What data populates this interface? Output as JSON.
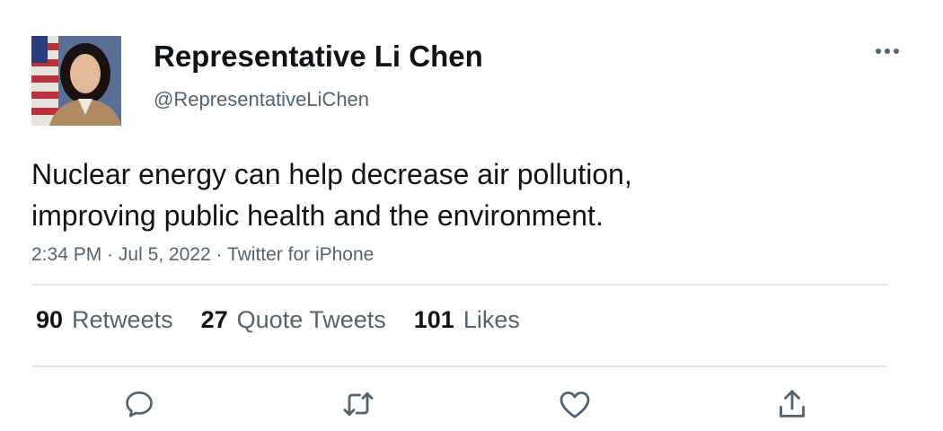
{
  "author": {
    "display_name": "Representative Li Chen",
    "handle": "@RepresentativeLiChen",
    "avatar_icon": "portrait-photo"
  },
  "tweet": {
    "text_line1": "Nuclear energy can help decrease air pollution,",
    "text_line2": "improving public health and the environment.",
    "time": "2:34 PM",
    "date": "Jul 5, 2022",
    "source": "Twitter for iPhone",
    "separator": " · "
  },
  "stats": {
    "retweets_count": "90",
    "retweets_label": "Retweets",
    "quotes_count": "27",
    "quotes_label": "Quote Tweets",
    "likes_count": "101",
    "likes_label": "Likes"
  },
  "actions": {
    "reply_icon": "reply-icon",
    "retweet_icon": "retweet-icon",
    "like_icon": "heart-icon",
    "share_icon": "share-icon",
    "more_icon": "more-dots-icon"
  },
  "colors": {
    "text_primary": "#0f1419",
    "text_secondary": "#536471",
    "divider": "#e4e7ea"
  }
}
